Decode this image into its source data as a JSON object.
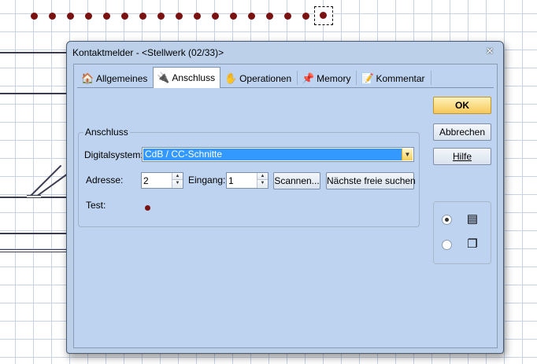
{
  "window": {
    "title": "Kontaktmelder - <Stellwerk (02/33)>",
    "close_glyph": "✕"
  },
  "tabs": [
    {
      "label": "Allgemeines",
      "icon": "house-icon",
      "glyph": "🏠",
      "active": false
    },
    {
      "label": "Anschluss",
      "icon": "plug-icon",
      "glyph": "🔌",
      "active": true
    },
    {
      "label": "Operationen",
      "icon": "operations-icon",
      "glyph": "✋",
      "active": false
    },
    {
      "label": "Memory",
      "icon": "pin-icon",
      "glyph": "📌",
      "active": false
    },
    {
      "label": "Kommentar",
      "icon": "comment-icon",
      "glyph": "📝",
      "active": false
    }
  ],
  "buttons": {
    "ok": "OK",
    "cancel": "Abbrechen",
    "help": "Hilfe"
  },
  "connection": {
    "group_title": "Anschluss",
    "digital_label": "Digitalsystem:",
    "digital_value": "CdB / CC-Schnitte",
    "address_label": "Adresse:",
    "address_value": "2",
    "input_label": "Eingang:",
    "input_value": "1",
    "scan_button": "Scannen...",
    "next_free_button": "Nächste freie suchen",
    "test_label": "Test:"
  },
  "view_options": {
    "selected_index": 0,
    "icons": [
      "list-view-icon",
      "copy-view-icon"
    ],
    "glyphs": [
      "▤",
      "❐"
    ]
  },
  "colors": {
    "dialog_bg": "#bed3ef",
    "selection": "#3399ff",
    "ok_button": "#f6c85a",
    "indicator": "#7a1212"
  }
}
